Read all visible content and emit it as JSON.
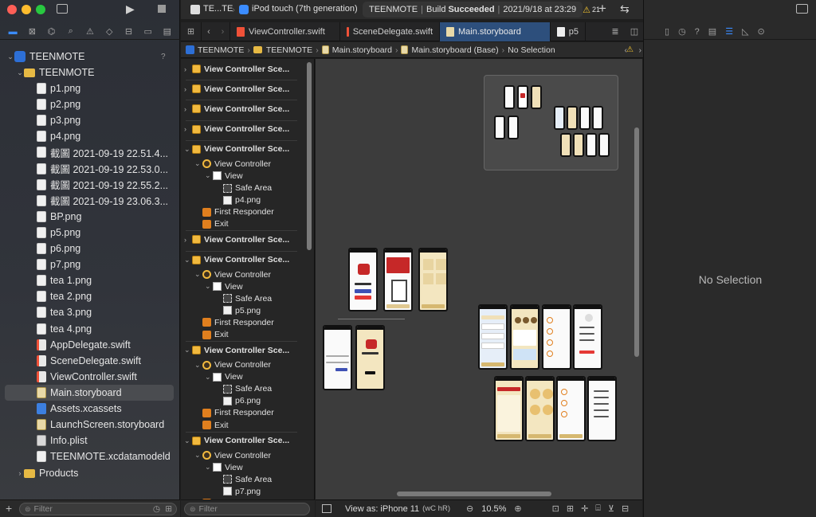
{
  "window": {
    "scheme": "TE...TE",
    "device": "iPod touch (7th generation)",
    "status_project": "TEENMOTE",
    "status_sep": "|",
    "status_build": "Build",
    "status_result": "Succeeded",
    "status_date": "2021/9/18 at 23:29",
    "warning_count": "21",
    "add_label": "+",
    "swap_label": "⇆"
  },
  "navigator": {
    "toolbar_icons": [
      "folder-icon",
      "source-control-icon",
      "hierarchy-icon",
      "find-icon",
      "warning-icon",
      "test-icon",
      "debug-icon",
      "breakpoint-icon",
      "report-icon"
    ],
    "root": {
      "label": "TEENMOTE",
      "badge": "?"
    },
    "group": {
      "label": "TEENMOTE"
    },
    "files": [
      {
        "label": "p1.png",
        "kind": "png"
      },
      {
        "label": "p2.png",
        "kind": "png"
      },
      {
        "label": "p3.png",
        "kind": "png"
      },
      {
        "label": "p4.png",
        "kind": "png"
      },
      {
        "label": "截圖 2021-09-19 22.51.4...",
        "kind": "png"
      },
      {
        "label": "截圖 2021-09-19 22.53.0...",
        "kind": "png"
      },
      {
        "label": "截圖 2021-09-19 22.55.2...",
        "kind": "png"
      },
      {
        "label": "截圖 2021-09-19 23.06.3...",
        "kind": "png"
      },
      {
        "label": "BP.png",
        "kind": "png"
      },
      {
        "label": "p5.png",
        "kind": "png"
      },
      {
        "label": "p6.png",
        "kind": "png"
      },
      {
        "label": "p7.png",
        "kind": "png"
      },
      {
        "label": "tea 1.png",
        "kind": "png"
      },
      {
        "label": "tea 2.png",
        "kind": "png"
      },
      {
        "label": "tea 3.png",
        "kind": "png"
      },
      {
        "label": "tea 4.png",
        "kind": "png"
      },
      {
        "label": "AppDelegate.swift",
        "kind": "swift"
      },
      {
        "label": "SceneDelegate.swift",
        "kind": "swift"
      },
      {
        "label": "ViewController.swift",
        "kind": "swift"
      },
      {
        "label": "Main.storyboard",
        "kind": "sb",
        "selected": true
      },
      {
        "label": "Assets.xcassets",
        "kind": "xca"
      },
      {
        "label": "LaunchScreen.storyboard",
        "kind": "sb"
      },
      {
        "label": "Info.plist",
        "kind": "plist"
      },
      {
        "label": "TEENMOTE.xcdatamodeld",
        "kind": "cd"
      }
    ],
    "products": {
      "label": "Products"
    },
    "filter_placeholder": "Filter"
  },
  "tabs": [
    {
      "label": "ViewController.swift",
      "kind": "swift"
    },
    {
      "label": "SceneDelegate.swift",
      "kind": "swift"
    },
    {
      "label": "Main.storyboard",
      "kind": "sb",
      "active": true
    },
    {
      "label": "p5",
      "kind": "png"
    }
  ],
  "jumpbar": [
    "TEENMOTE",
    "TEENMOTE",
    "Main.storyboard",
    "Main.storyboard (Base)",
    "No Selection"
  ],
  "outline": {
    "scene_label": "View Controller Sce...",
    "vc_label": "View Controller",
    "view_label": "View",
    "safe_label": "Safe Area",
    "fr_label": "First Responder",
    "exit_label": "Exit",
    "expanded_images": [
      "p4.png",
      "p5.png",
      "p6.png",
      "p7.png"
    ],
    "filter_placeholder": "Filter"
  },
  "canvas_footer": {
    "view_as": "View as: iPhone 11",
    "traits": "(wC hR)",
    "zoom_out": "−",
    "zoom": "10.5%",
    "zoom_in": "+"
  },
  "inspector": {
    "empty_label": "No Selection",
    "toolbar_icons": [
      "file-icon",
      "history-icon",
      "help-icon",
      "identity-icon",
      "attributes-icon",
      "size-icon",
      "connections-icon"
    ]
  },
  "colors": {
    "accent": "#3b8cff",
    "tab_active": "#2d4f7c",
    "warning": "#f4c430",
    "storyboard_red": "#c62828",
    "tea_beige": "#f0e0b8"
  }
}
